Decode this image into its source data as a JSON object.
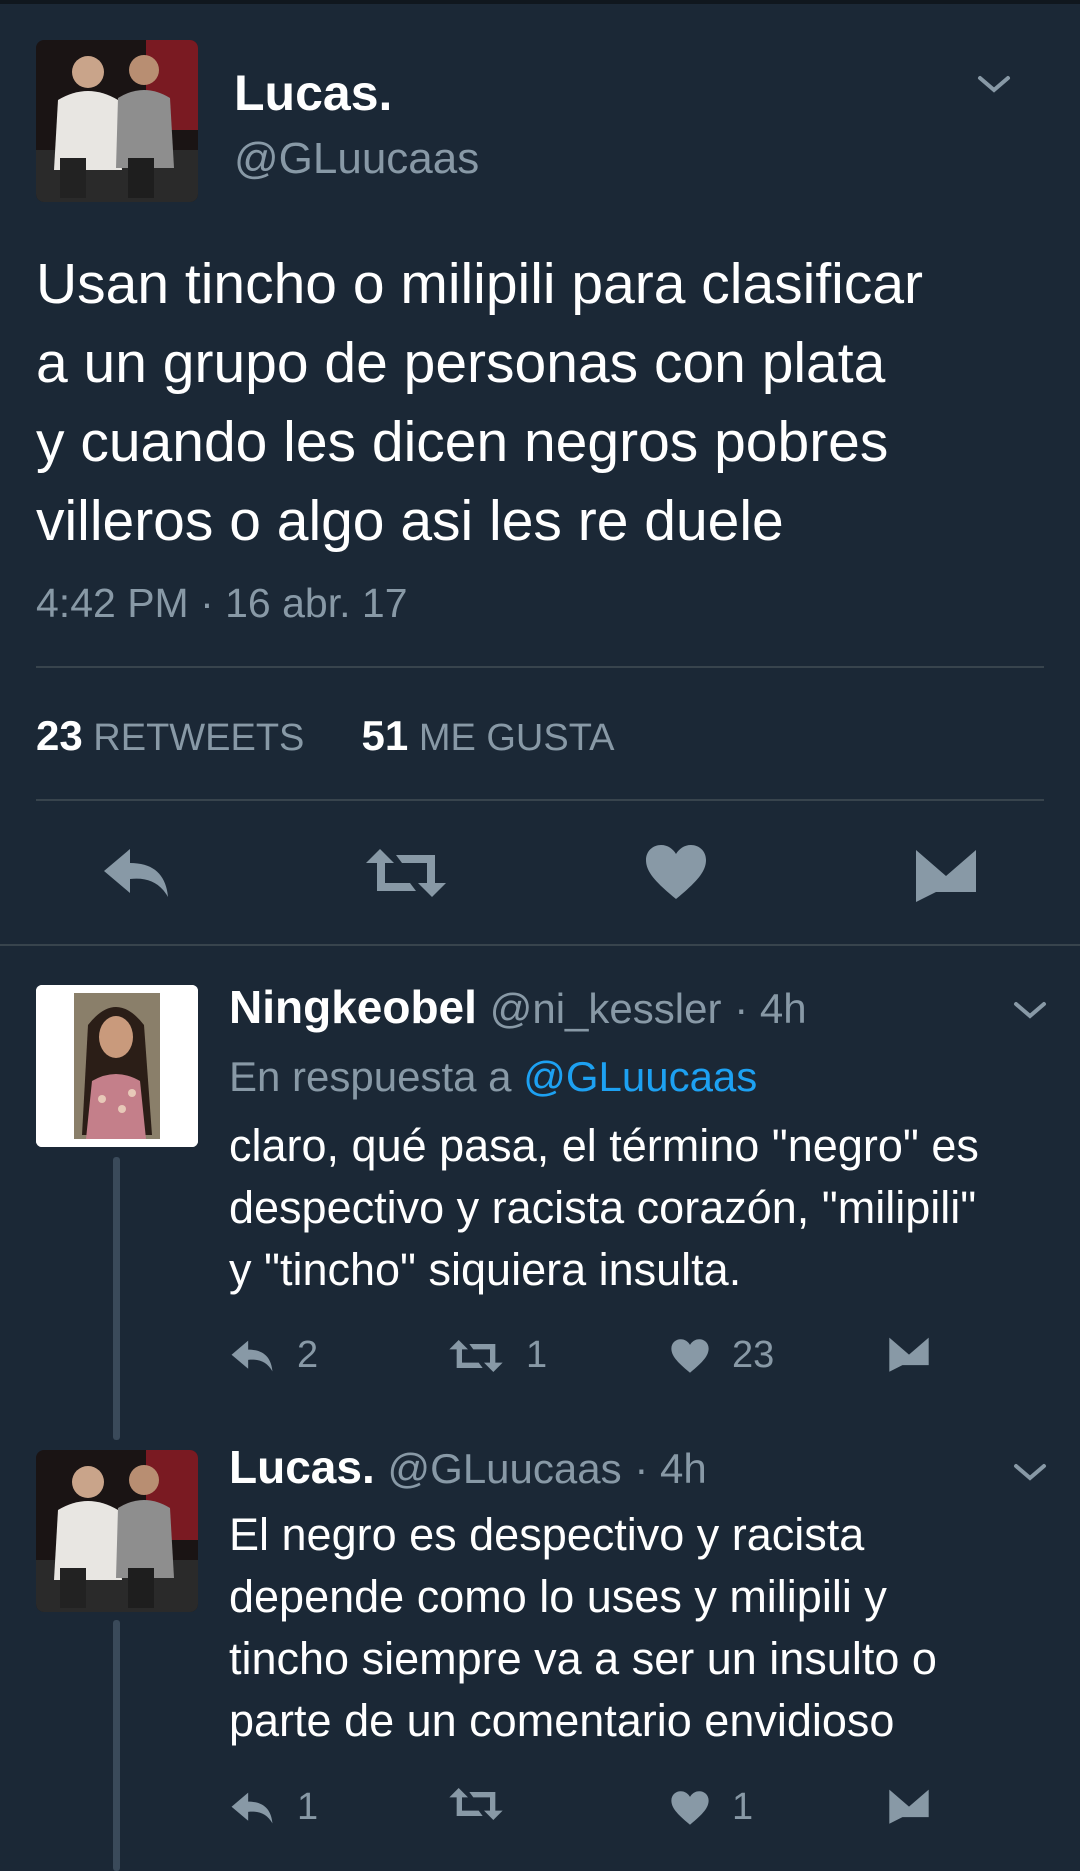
{
  "main_tweet": {
    "name": "Lucas.",
    "handle": "@GLuucaas",
    "text_lines": [
      "Usan tincho o milipili para clasificar",
      "a un grupo de personas con plata",
      "y cuando les dicen negros pobres",
      "villeros o algo asi les re duele"
    ],
    "timestamp": "4:42 PM · 16 abr. 17",
    "retweets_count": "23",
    "retweets_label": "RETWEETS",
    "likes_count": "51",
    "likes_label": "ME GUSTA",
    "actions": [
      "reply-icon",
      "retweet-icon",
      "heart-icon",
      "message-icon"
    ]
  },
  "replies": [
    {
      "name": "Ningkeobel",
      "handle": "@ni_kessler",
      "time": "· 4h",
      "in_reply_prefix": "En respuesta a ",
      "in_reply_handle": "@GLuucaas",
      "text_lines": [
        "claro, qué pasa, el término \"negro\" es",
        "despectivo y racista corazón, \"milipili\"",
        "y \"tincho\" siquiera insulta."
      ],
      "reply_count": "2",
      "retweet_count": "1",
      "like_count": "23"
    },
    {
      "name": "Lucas.",
      "handle": "@GLuucaas",
      "time": "· 4h",
      "text_lines": [
        "El negro es despectivo y racista",
        "depende como lo uses y milipili y",
        "tincho siempre va a ser un insulto o",
        "parte de un comentario envidioso"
      ],
      "reply_count": "1",
      "retweet_count": "",
      "like_count": "1"
    }
  ],
  "colors": {
    "background": "#1b2836",
    "secondary_text": "#8899a6",
    "link": "#1da1f2",
    "divider": "#38444d"
  }
}
